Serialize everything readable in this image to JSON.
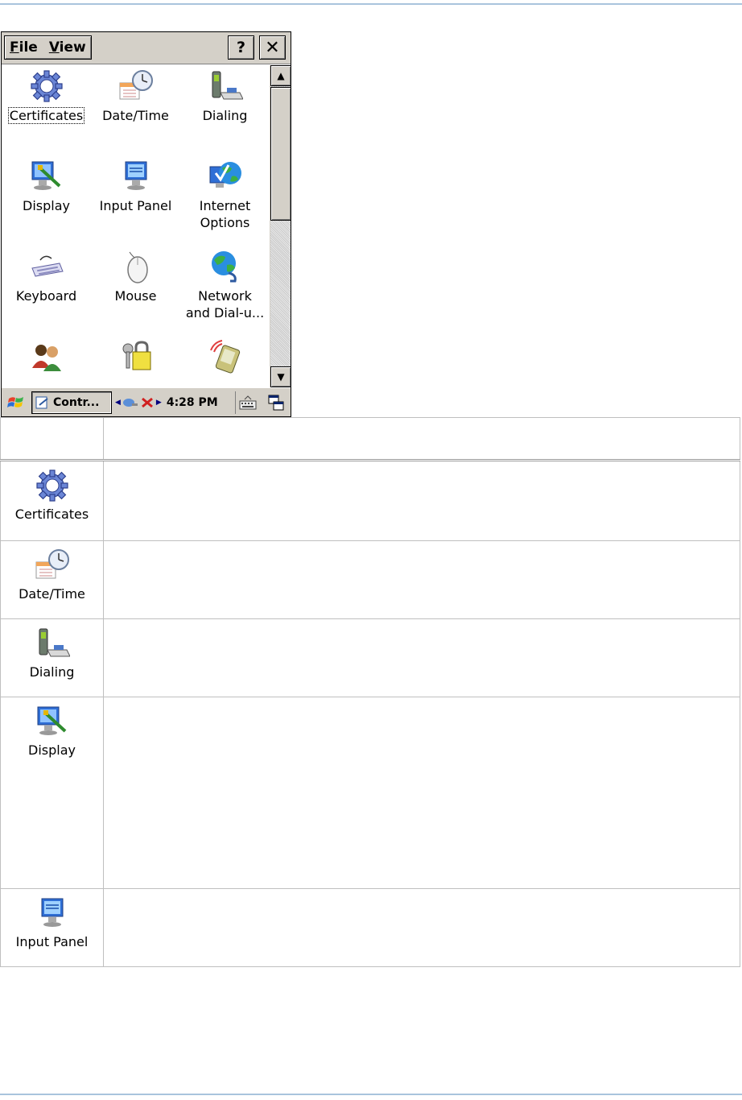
{
  "window": {
    "menu": {
      "file": "File",
      "view": "View"
    },
    "help_label": "?",
    "close_label": "✕",
    "icons": [
      {
        "label": "Certificates",
        "icon": "gear-icon",
        "selected": true
      },
      {
        "label": "Date/Time",
        "icon": "calendar-clock-icon"
      },
      {
        "label": "Dialing",
        "icon": "phone-modem-icon"
      },
      {
        "label": "Display",
        "icon": "monitor-brush-icon"
      },
      {
        "label": "Input Panel",
        "icon": "monitor-keyboard-icon"
      },
      {
        "label": "Internet Options",
        "icon": "globe-check-icon"
      },
      {
        "label": "Keyboard",
        "icon": "keyboard-icon"
      },
      {
        "label": "Mouse",
        "icon": "mouse-icon"
      },
      {
        "label": "Network and Dial-u...",
        "icon": "network-globe-icon"
      },
      {
        "label": "",
        "icon": "users-icon"
      },
      {
        "label": "",
        "icon": "keys-lock-icon"
      },
      {
        "label": "",
        "icon": "pda-signal-icon"
      }
    ],
    "taskbar": {
      "task_label": "Contr...",
      "clock": "4:28 PM"
    }
  },
  "table": {
    "header": [
      "",
      ""
    ],
    "rows": [
      {
        "label": "Certificates",
        "icon": "gear-icon",
        "description": ""
      },
      {
        "label": "Date/Time",
        "icon": "calendar-clock-icon",
        "description": ""
      },
      {
        "label": "Dialing",
        "icon": "phone-modem-icon",
        "description": ""
      },
      {
        "label": "Display",
        "icon": "monitor-brush-icon",
        "description": ""
      },
      {
        "label": "Input Panel",
        "icon": "monitor-keyboard-icon",
        "description": ""
      }
    ]
  }
}
